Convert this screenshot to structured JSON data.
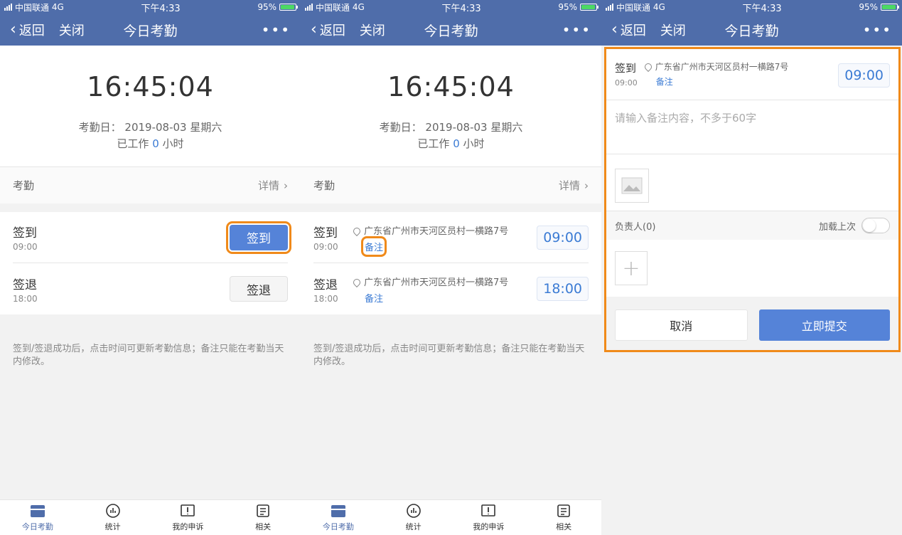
{
  "status": {
    "carrier": "中国联通",
    "network": "4G",
    "time": "下午4:33",
    "battery": "95%"
  },
  "nav": {
    "back": "返回",
    "close": "关闭",
    "title": "今日考勤",
    "more": "•••"
  },
  "clock": {
    "time": "16:45:04",
    "date_line": "考勤日： 2019-08-03 星期六",
    "work_prefix": "已工作",
    "work_hours": "0",
    "work_suffix": "小时"
  },
  "section": {
    "title": "考勤",
    "detail": "详情"
  },
  "checkin": {
    "label": "签到",
    "time": "09:00",
    "button": "签到"
  },
  "checkout": {
    "label": "签退",
    "time": "18:00",
    "button": "签退",
    "time_value": "18:00"
  },
  "address": "广东省广州市天河区员村一横路7号",
  "note_label": "备注",
  "checkin_time_value": "09:00",
  "tip": "签到/签退成功后，点击时间可更新考勤信息；备注只能在考勤当天内修改。",
  "tabs": [
    {
      "label": "今日考勤",
      "icon": "calendar-icon"
    },
    {
      "label": "统计",
      "icon": "stats-icon"
    },
    {
      "label": "我的申诉",
      "icon": "appeal-icon"
    },
    {
      "label": "相关",
      "icon": "related-icon"
    }
  ],
  "form": {
    "placeholder": "请输入备注内容，不多于60字",
    "owner_label": "负责人(0)",
    "load_last": "加载上次",
    "cancel": "取消",
    "submit": "立即提交"
  },
  "colors": {
    "nav": "#4f6daa",
    "accent": "#5583d8",
    "highlight": "#f08a1a"
  }
}
